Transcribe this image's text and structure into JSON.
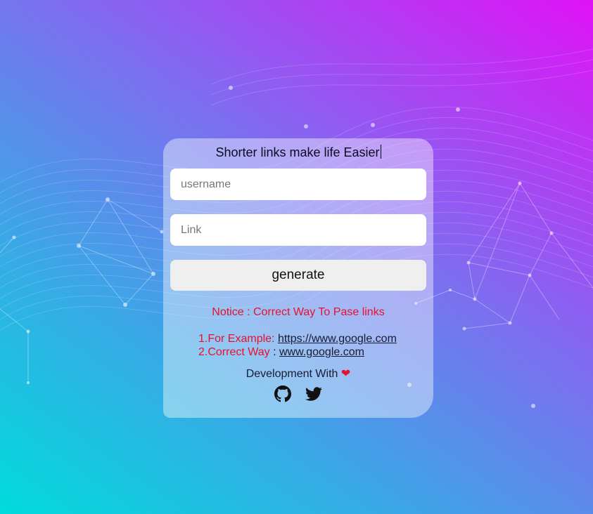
{
  "header": {
    "title": "Shorter links make life Easier"
  },
  "form": {
    "username_placeholder": "username",
    "username_value": "",
    "link_placeholder": "Link",
    "link_value": "",
    "generate_label": "generate"
  },
  "notice": {
    "text": "Notice : Correct Way To Pase links",
    "example_prefix": "1.For Example: ",
    "example_link": "https://www.google.com",
    "correct_prefix": "2.Correct Way",
    "correct_sep": " : ",
    "correct_link": "www.google.com"
  },
  "footer": {
    "dev_text": "Development With ",
    "heart_icon": "heart-icon",
    "social_icons": [
      "github-icon",
      "twitter-icon"
    ]
  },
  "colors": {
    "accent_red": "#e8112d",
    "gradient_start": "#00dbdc",
    "gradient_end": "#e012f6"
  }
}
